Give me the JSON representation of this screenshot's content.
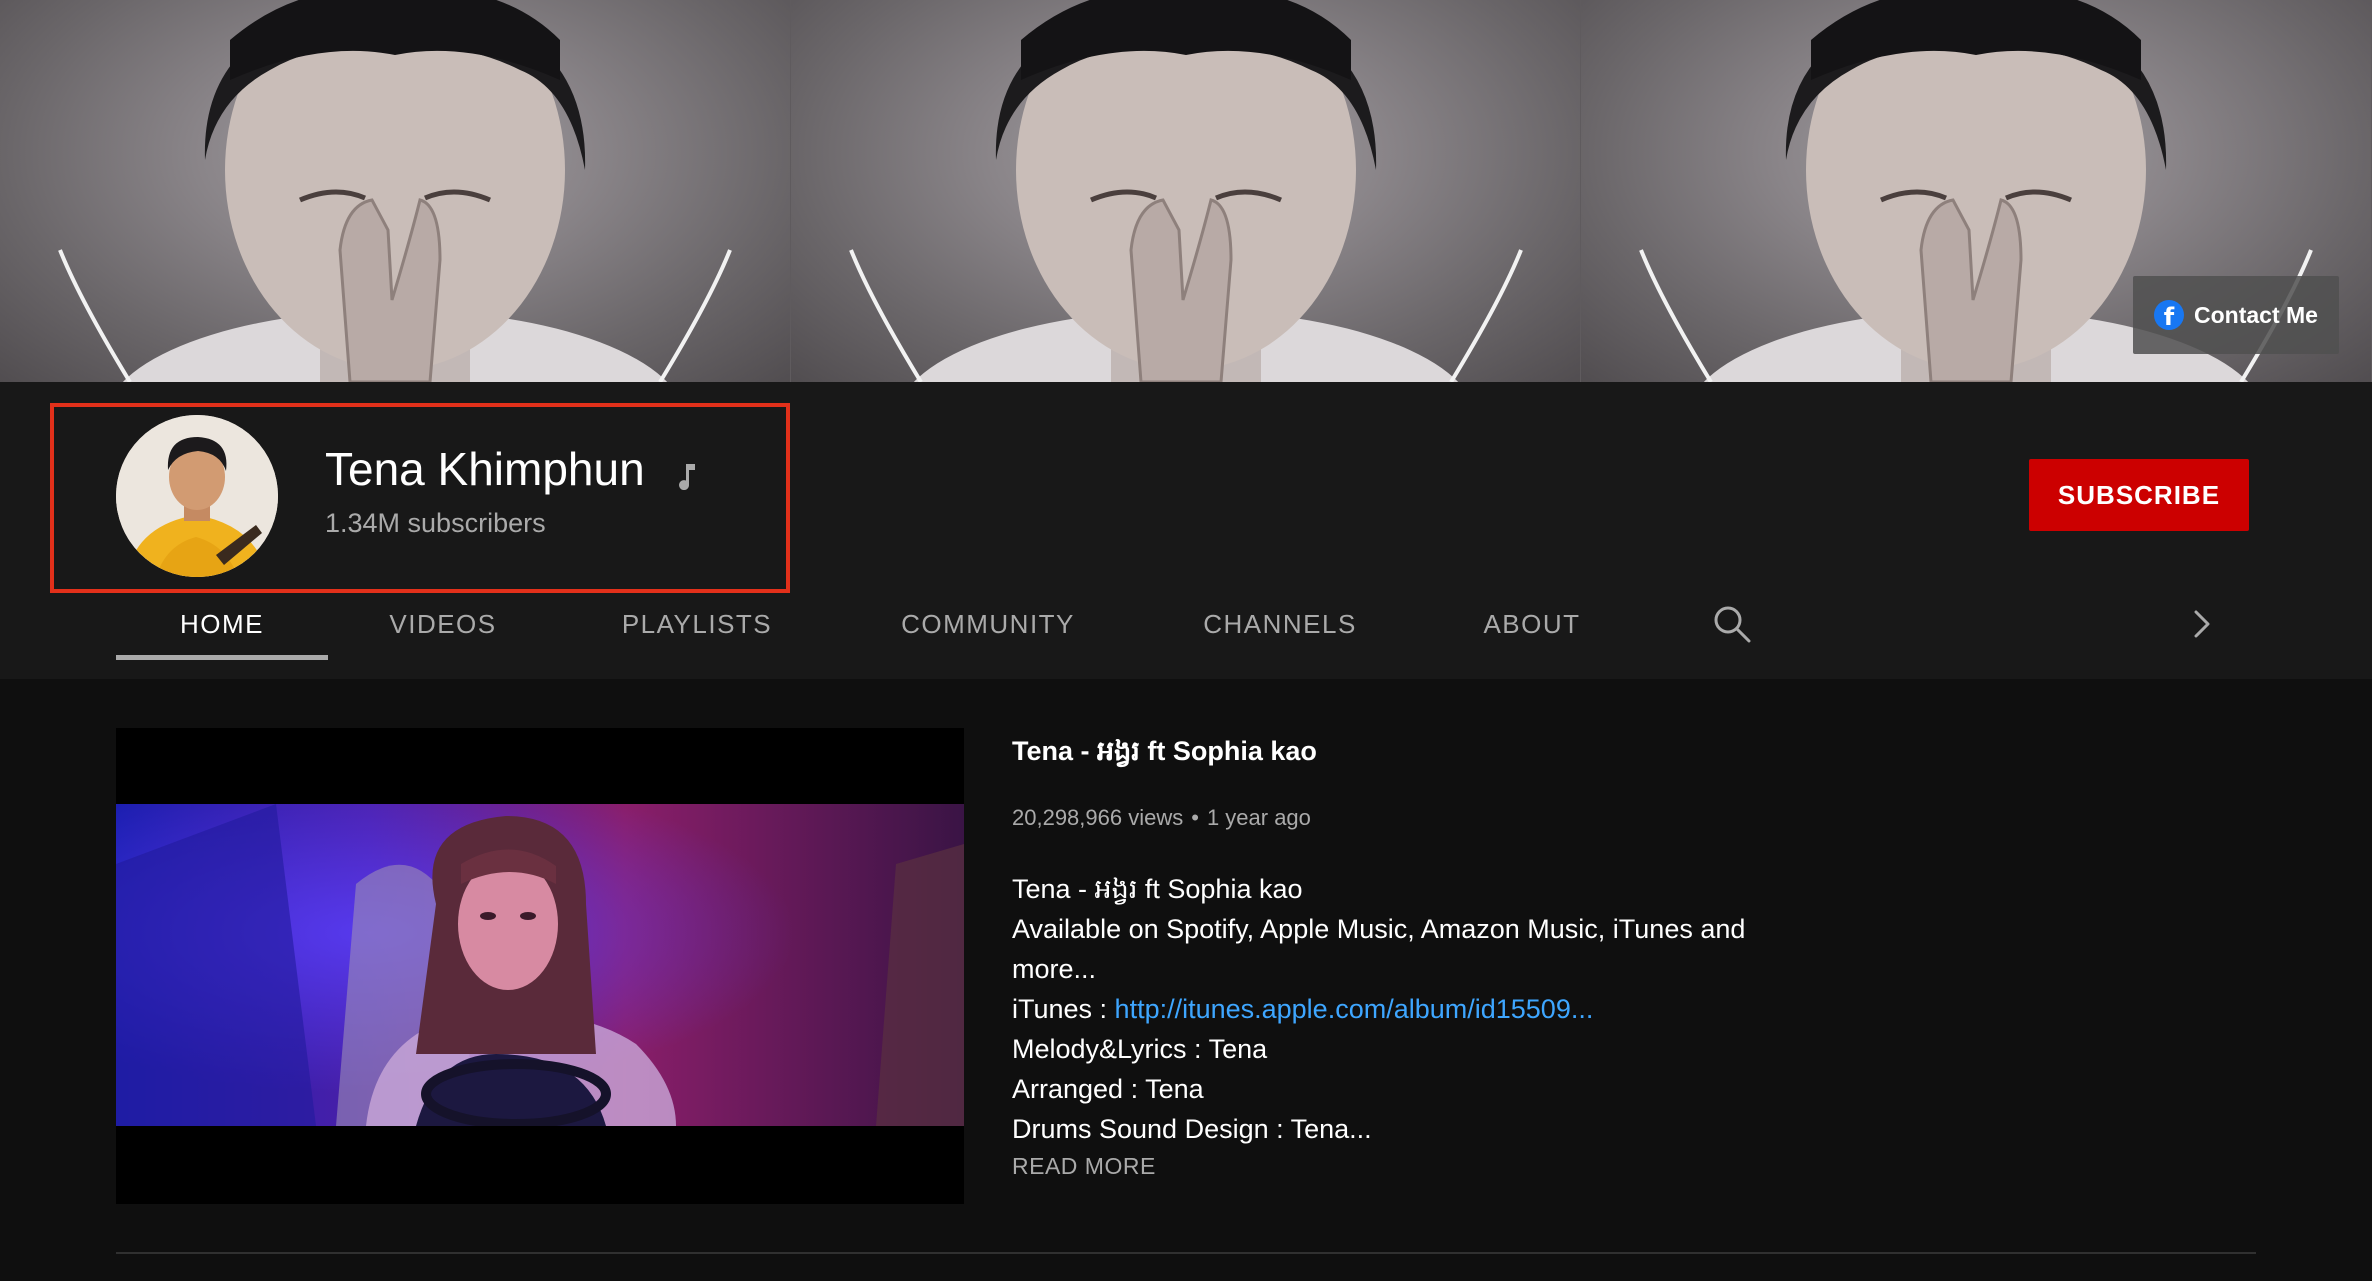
{
  "banner": {
    "contact_label": "Contact Me",
    "contact_icon": "facebook-icon"
  },
  "channel": {
    "name": "Tena Khimphun",
    "subscribers": "1.34M subscribers",
    "badge_icon": "music-note-icon",
    "subscribe_label": "SUBSCRIBE",
    "highlight_color": "#e2301a",
    "subscribe_color": "#cc0000"
  },
  "tabs": [
    {
      "label": "HOME",
      "active": true
    },
    {
      "label": "VIDEOS",
      "active": false
    },
    {
      "label": "PLAYLISTS",
      "active": false
    },
    {
      "label": "COMMUNITY",
      "active": false
    },
    {
      "label": "CHANNELS",
      "active": false
    },
    {
      "label": "ABOUT",
      "active": false
    }
  ],
  "featured_video": {
    "title": "Tena - អង្វរ ft Sophia kao",
    "views": "20,298,966 views",
    "separator": "•",
    "age": "1 year ago",
    "description": {
      "line1": "Tena - អង្វរ ft Sophia kao",
      "line2": "Available on Spotify, Apple Music, Amazon Music, iTunes and",
      "line3": "more...",
      "itunes_label": "iTunes : ",
      "itunes_link": "http://itunes.apple.com/album/id15509...",
      "line5": "Melody&Lyrics : Tena",
      "line6": "Arranged : Tena",
      "line7": "Drums Sound Design : Tena..."
    },
    "read_more": "READ MORE",
    "link_color": "#3ea6ff"
  }
}
